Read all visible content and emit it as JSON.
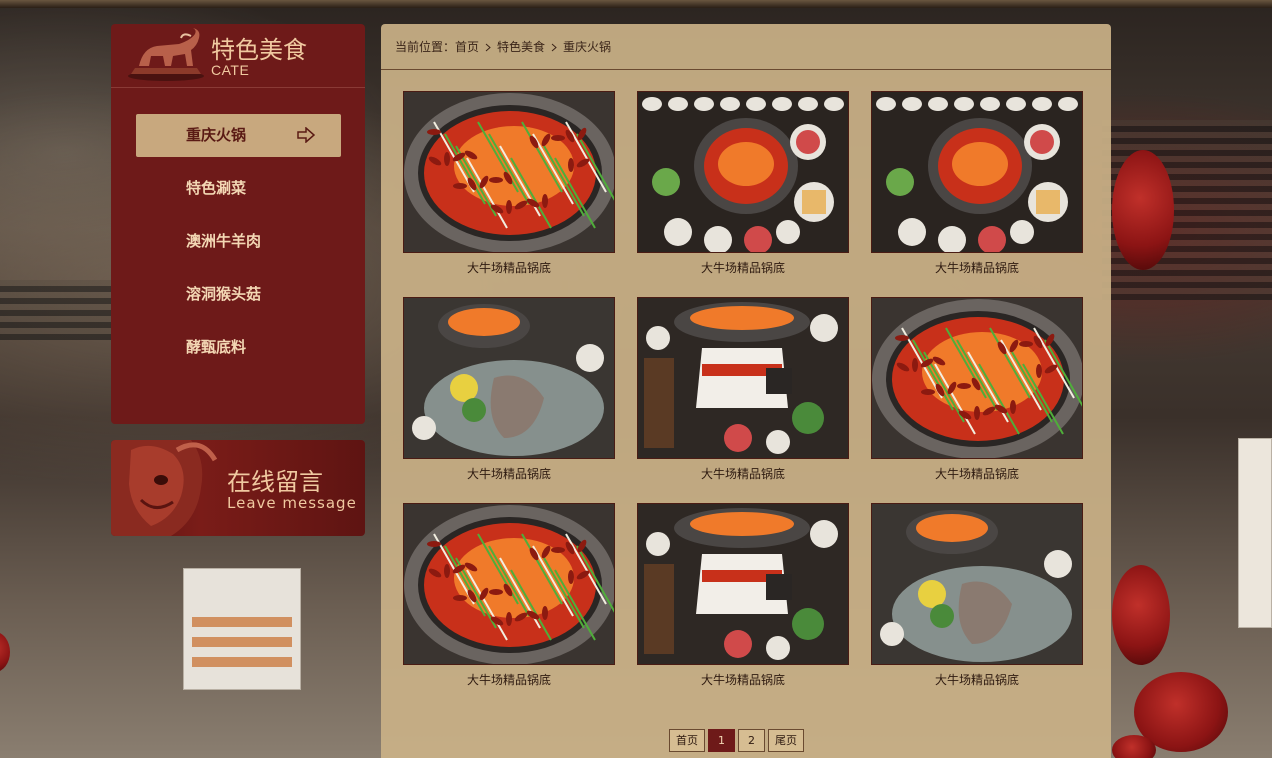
{
  "sidebar": {
    "title": "特色美食",
    "subtitle": "CATE",
    "items": [
      {
        "label": "重庆火锅",
        "active": true
      },
      {
        "label": "特色涮菜",
        "active": false
      },
      {
        "label": "澳洲牛羊肉",
        "active": false
      },
      {
        "label": "溶洞猴头菇",
        "active": false
      },
      {
        "label": "酵甄底料",
        "active": false
      }
    ]
  },
  "message_box": {
    "title": "在线留言",
    "subtitle": "Leave message"
  },
  "breadcrumb": {
    "prefix": "当前位置：",
    "items": [
      "首页",
      "特色美食",
      "重庆火锅"
    ]
  },
  "products": [
    {
      "caption": "大牛场精品锅底",
      "style": "closeup"
    },
    {
      "caption": "大牛场精品锅底",
      "style": "table"
    },
    {
      "caption": "大牛场精品锅底",
      "style": "table"
    },
    {
      "caption": "大牛场精品锅底",
      "style": "spread"
    },
    {
      "caption": "大牛场精品锅底",
      "style": "stove"
    },
    {
      "caption": "大牛场精品锅底",
      "style": "closeup"
    },
    {
      "caption": "大牛场精品锅底",
      "style": "closeup"
    },
    {
      "caption": "大牛场精品锅底",
      "style": "stove"
    },
    {
      "caption": "大牛场精品锅底",
      "style": "spread"
    }
  ],
  "pagination": {
    "first": "首页",
    "pages": [
      "1",
      "2"
    ],
    "current": "1",
    "last": "尾页"
  },
  "colors": {
    "sidebar_bg": "#6e1a19",
    "active_item_bg": "#c8a87e",
    "panel_bg": "#c9b086",
    "text_cream": "#f0c9a0"
  }
}
